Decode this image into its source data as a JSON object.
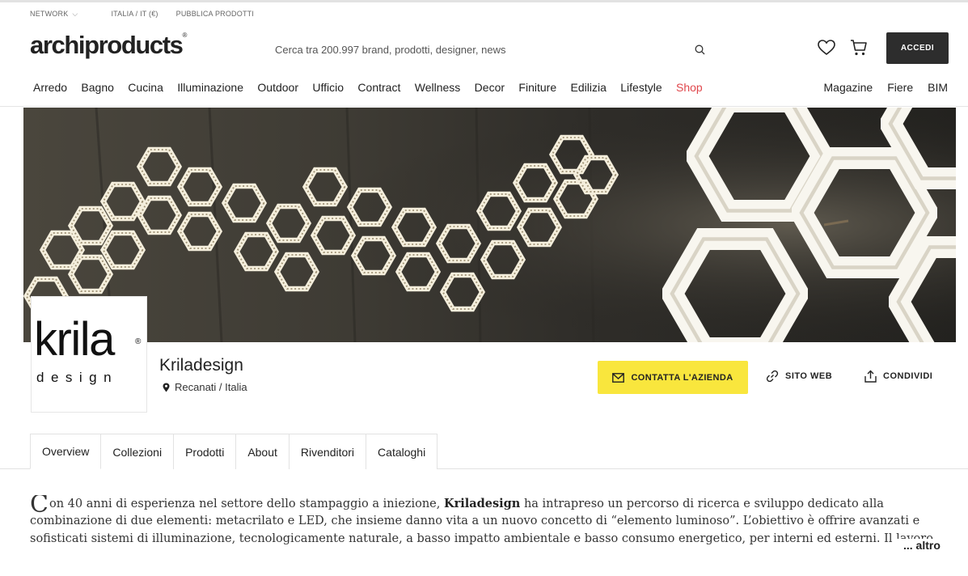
{
  "utility": {
    "network": "NETWORK",
    "country": "ITALIA / IT (€)",
    "publish": "PUBBLICA PRODOTTI"
  },
  "header": {
    "logo": "archiproducts",
    "search_placeholder": "Cerca tra 200.997 brand, prodotti, designer, news",
    "login": "ACCEDI"
  },
  "nav": {
    "main": [
      "Arredo",
      "Bagno",
      "Cucina",
      "Illuminazione",
      "Outdoor",
      "Ufficio",
      "Contract",
      "Wellness",
      "Decor",
      "Finiture",
      "Edilizia",
      "Lifestyle",
      "Shop"
    ],
    "side": [
      "Magazine",
      "Fiere",
      "BIM"
    ]
  },
  "brand": {
    "logo_main": "krila",
    "logo_sub": "design",
    "name": "Kriladesign",
    "location": "Recanati / Italia"
  },
  "actions": {
    "contact": "CONTATTA L'AZIENDA",
    "website": "SITO WEB",
    "share": "CONDIVIDI"
  },
  "tabs": [
    "Overview",
    "Collezioni",
    "Prodotti",
    "About",
    "Rivenditori",
    "Cataloghi"
  ],
  "description": {
    "dropcap": "C",
    "part1": "on 40 anni di esperienza nel settore dello stampaggio a iniezione, ",
    "bold": "Kriladesign",
    "part2": " ha intrapreso un percorso di ricerca e sviluppo dedicato alla combinazione di due elementi: metacrilato e LED, che insieme danno vita a un nuovo concetto di “elemento luminoso”. L’obiettivo è offrire avanzati e sofisticati sistemi di illuminazione, tecnologicamente naturale, a basso impatto ambientale e basso consumo energetico, per interni ed esterni. Il lavoro dell'azienda viene ar",
    "more": "... altro"
  },
  "colors": {
    "accent_yellow": "#f9e63d",
    "shop_red": "#e0474c",
    "login_bg": "#2d2d2d"
  },
  "icons": [
    "flag-italy-icon",
    "chevron-down-icon",
    "search-icon",
    "heart-icon",
    "cart-icon",
    "map-pin-icon",
    "mail-icon",
    "link-icon",
    "share-icon"
  ]
}
